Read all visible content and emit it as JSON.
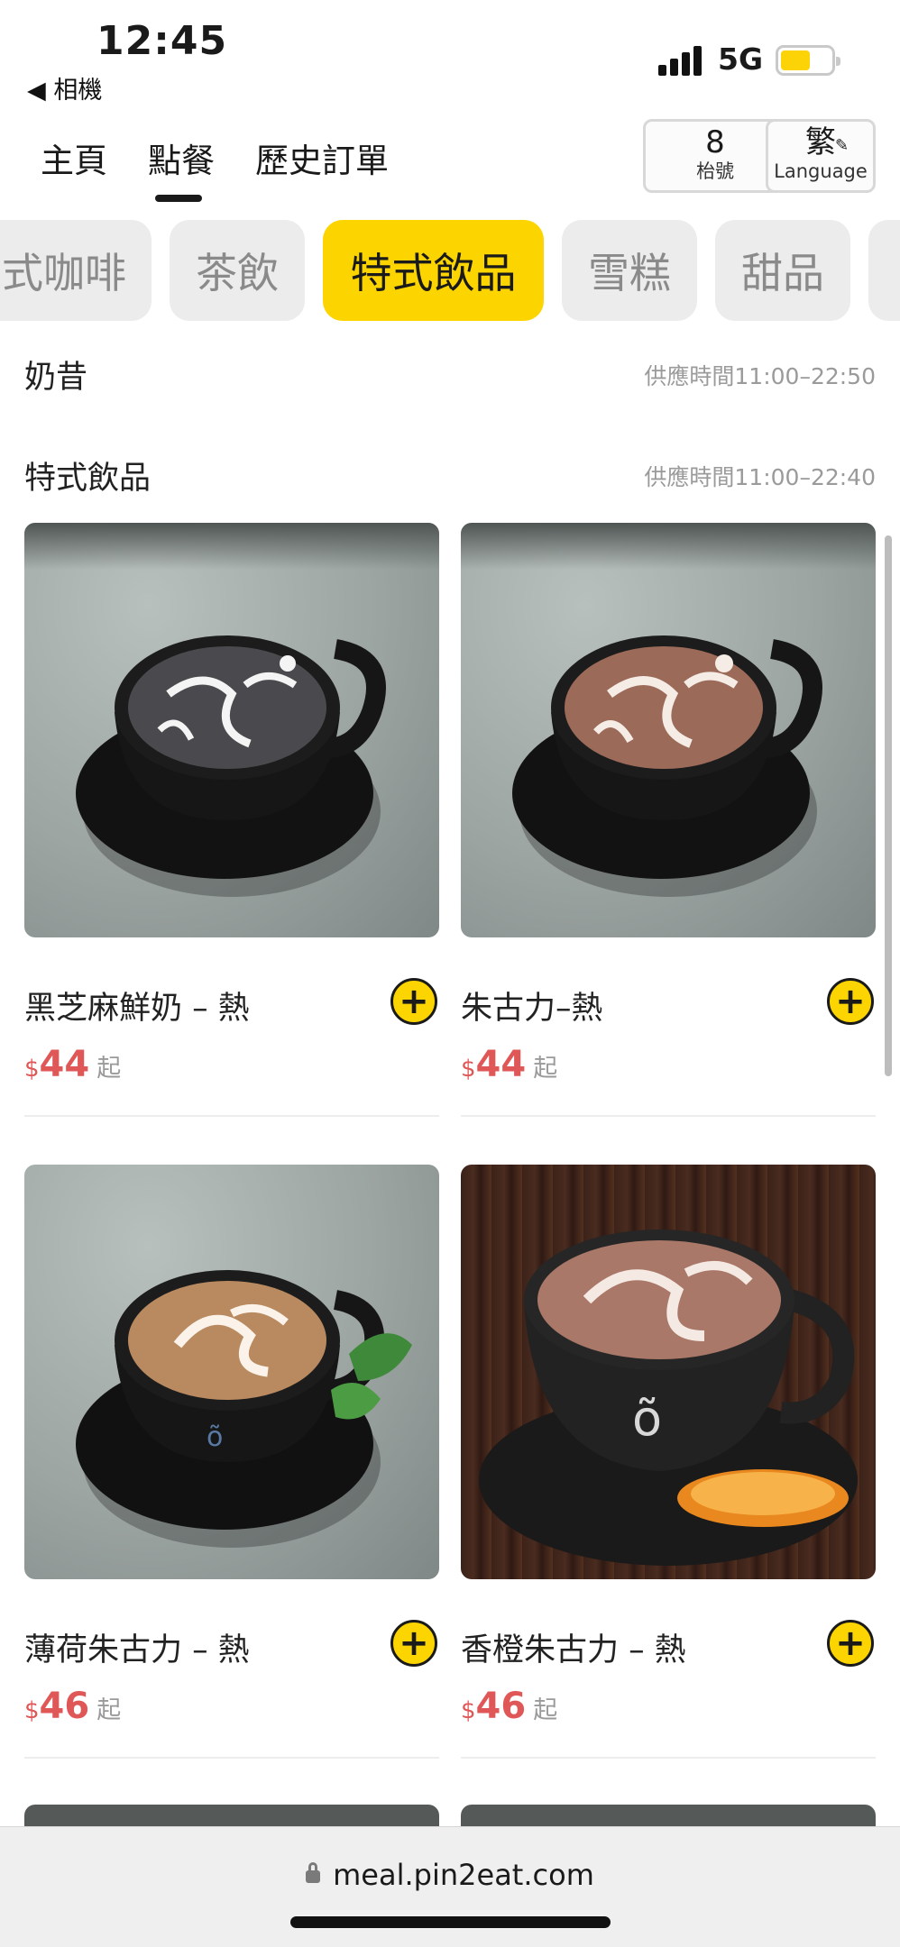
{
  "status_bar": {
    "time": "12:45",
    "back_label": "◀ 相機",
    "network": "5G",
    "battery_level": 0.6,
    "battery_color": "#fcd307"
  },
  "nav": {
    "tabs": [
      {
        "label": "主頁"
      },
      {
        "label": "點餐",
        "active": true
      },
      {
        "label": "歷史訂單"
      }
    ],
    "table_number": "8",
    "table_label": "枱號",
    "language_char": "繁",
    "language_label": "Language",
    "language_icon": "pencil-icon"
  },
  "categories": [
    {
      "label": "式咖啡"
    },
    {
      "label": "茶飲"
    },
    {
      "label": "特式飲品",
      "active": true
    },
    {
      "label": "雪糕"
    },
    {
      "label": "甜品"
    }
  ],
  "sections": [
    {
      "title": "奶昔",
      "hours": "供應時間11:00–22:50"
    },
    {
      "title": "特式飲品",
      "hours": "供應時間11:00–22:40"
    }
  ],
  "products": [
    {
      "name": "黑芝麻鮮奶 – 熱",
      "currency": "$",
      "price": "44",
      "from": "起"
    },
    {
      "name": "朱古力–熱",
      "currency": "$",
      "price": "44",
      "from": "起"
    },
    {
      "name": "薄荷朱古力 – 熱",
      "currency": "$",
      "price": "46",
      "from": "起"
    },
    {
      "name": "香橙朱古力 – 熱",
      "currency": "$",
      "price": "46",
      "from": "起"
    }
  ],
  "browser": {
    "url": "meal.pin2eat.com"
  },
  "colors": {
    "accent": "#fcd500",
    "price": "#e05757"
  }
}
